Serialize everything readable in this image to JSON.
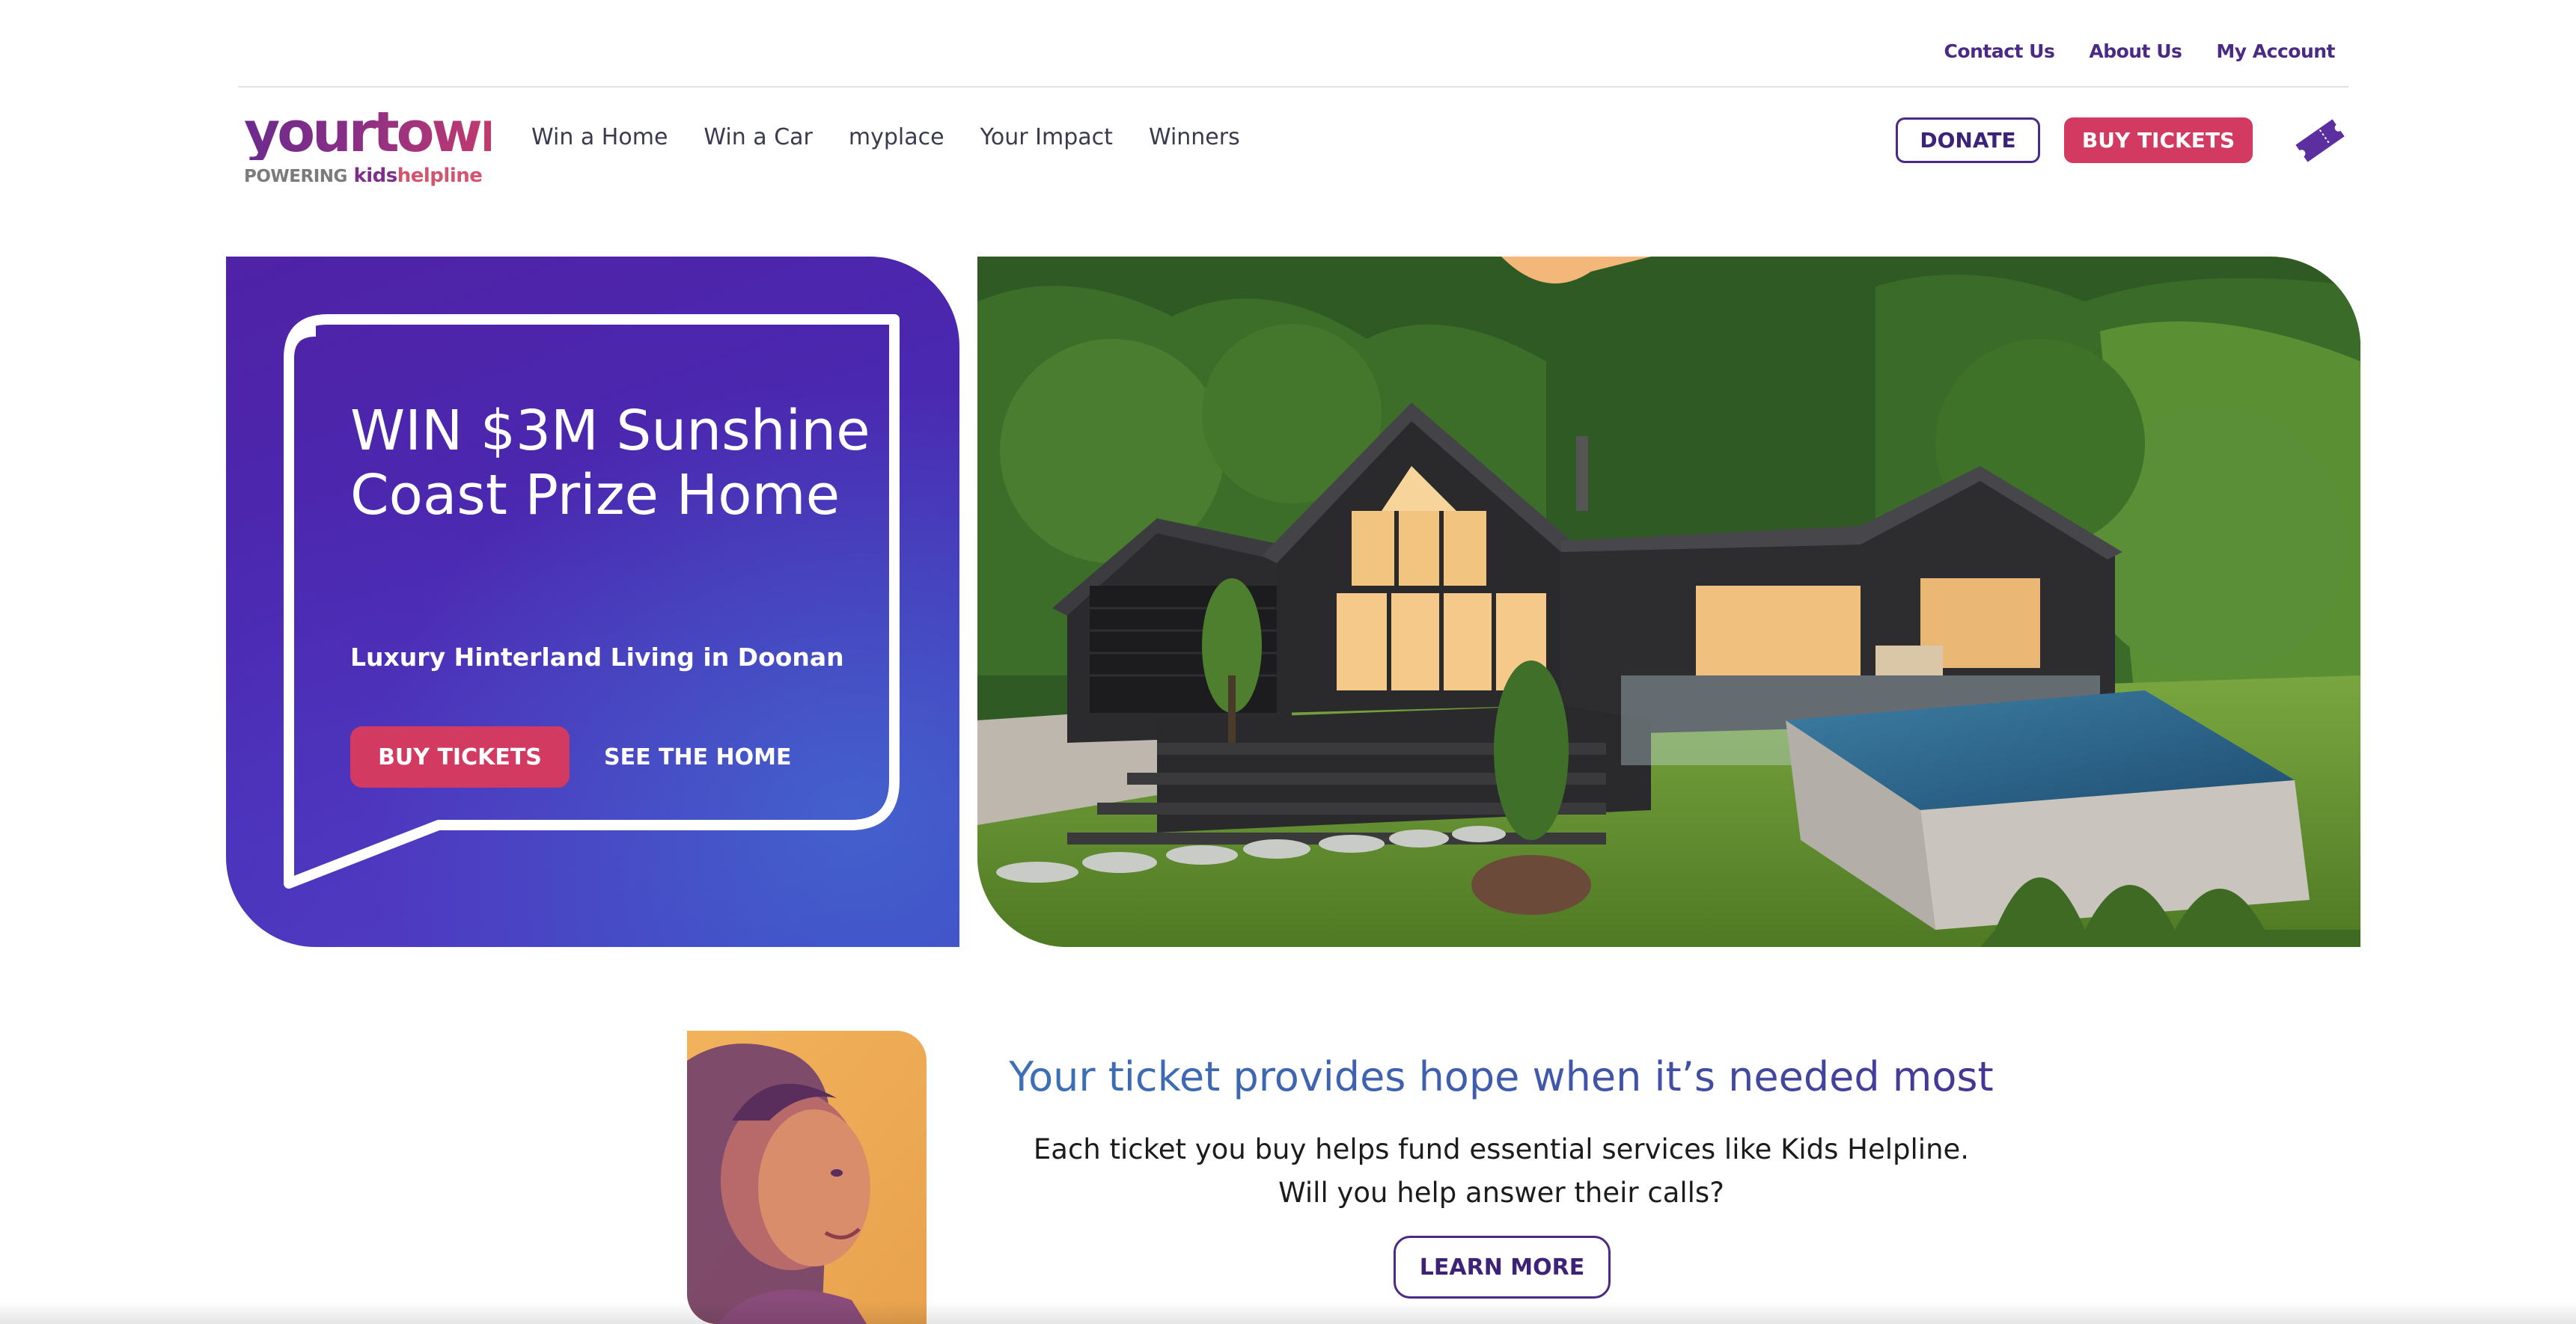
{
  "utility_nav": {
    "contact": "Contact Us",
    "about": "About Us",
    "account": "My Account"
  },
  "logo": {
    "word": "yourtown",
    "powering": "POWERING",
    "kids": "kids",
    "helpline": "helpline"
  },
  "main_nav": {
    "items": [
      {
        "label": "Win a Home"
      },
      {
        "label": "Win a Car"
      },
      {
        "label": "myplace"
      },
      {
        "label": "Your Impact"
      },
      {
        "label": "Winners"
      }
    ]
  },
  "header_actions": {
    "donate": "DONATE",
    "buy_tickets": "BUY TICKETS",
    "ticket_icon": "ticket-icon"
  },
  "hero": {
    "title": "WIN $3M Sunshine Coast Prize Home",
    "subtitle": "Luxury Hinterland Living in Doonan",
    "buy_tickets": "BUY TICKETS",
    "see_home": "SEE THE HOME"
  },
  "impact": {
    "heading": "Your ticket provides hope when it’s needed most",
    "body": "Each ticket you buy helps fund essential services like Kids Helpline. Will you help answer their calls?",
    "learn_more": "LEARN MORE"
  },
  "colors": {
    "brand_purple": "#4a2a84",
    "brand_pink": "#d23a62",
    "hero_panel": "#4a28b0"
  }
}
